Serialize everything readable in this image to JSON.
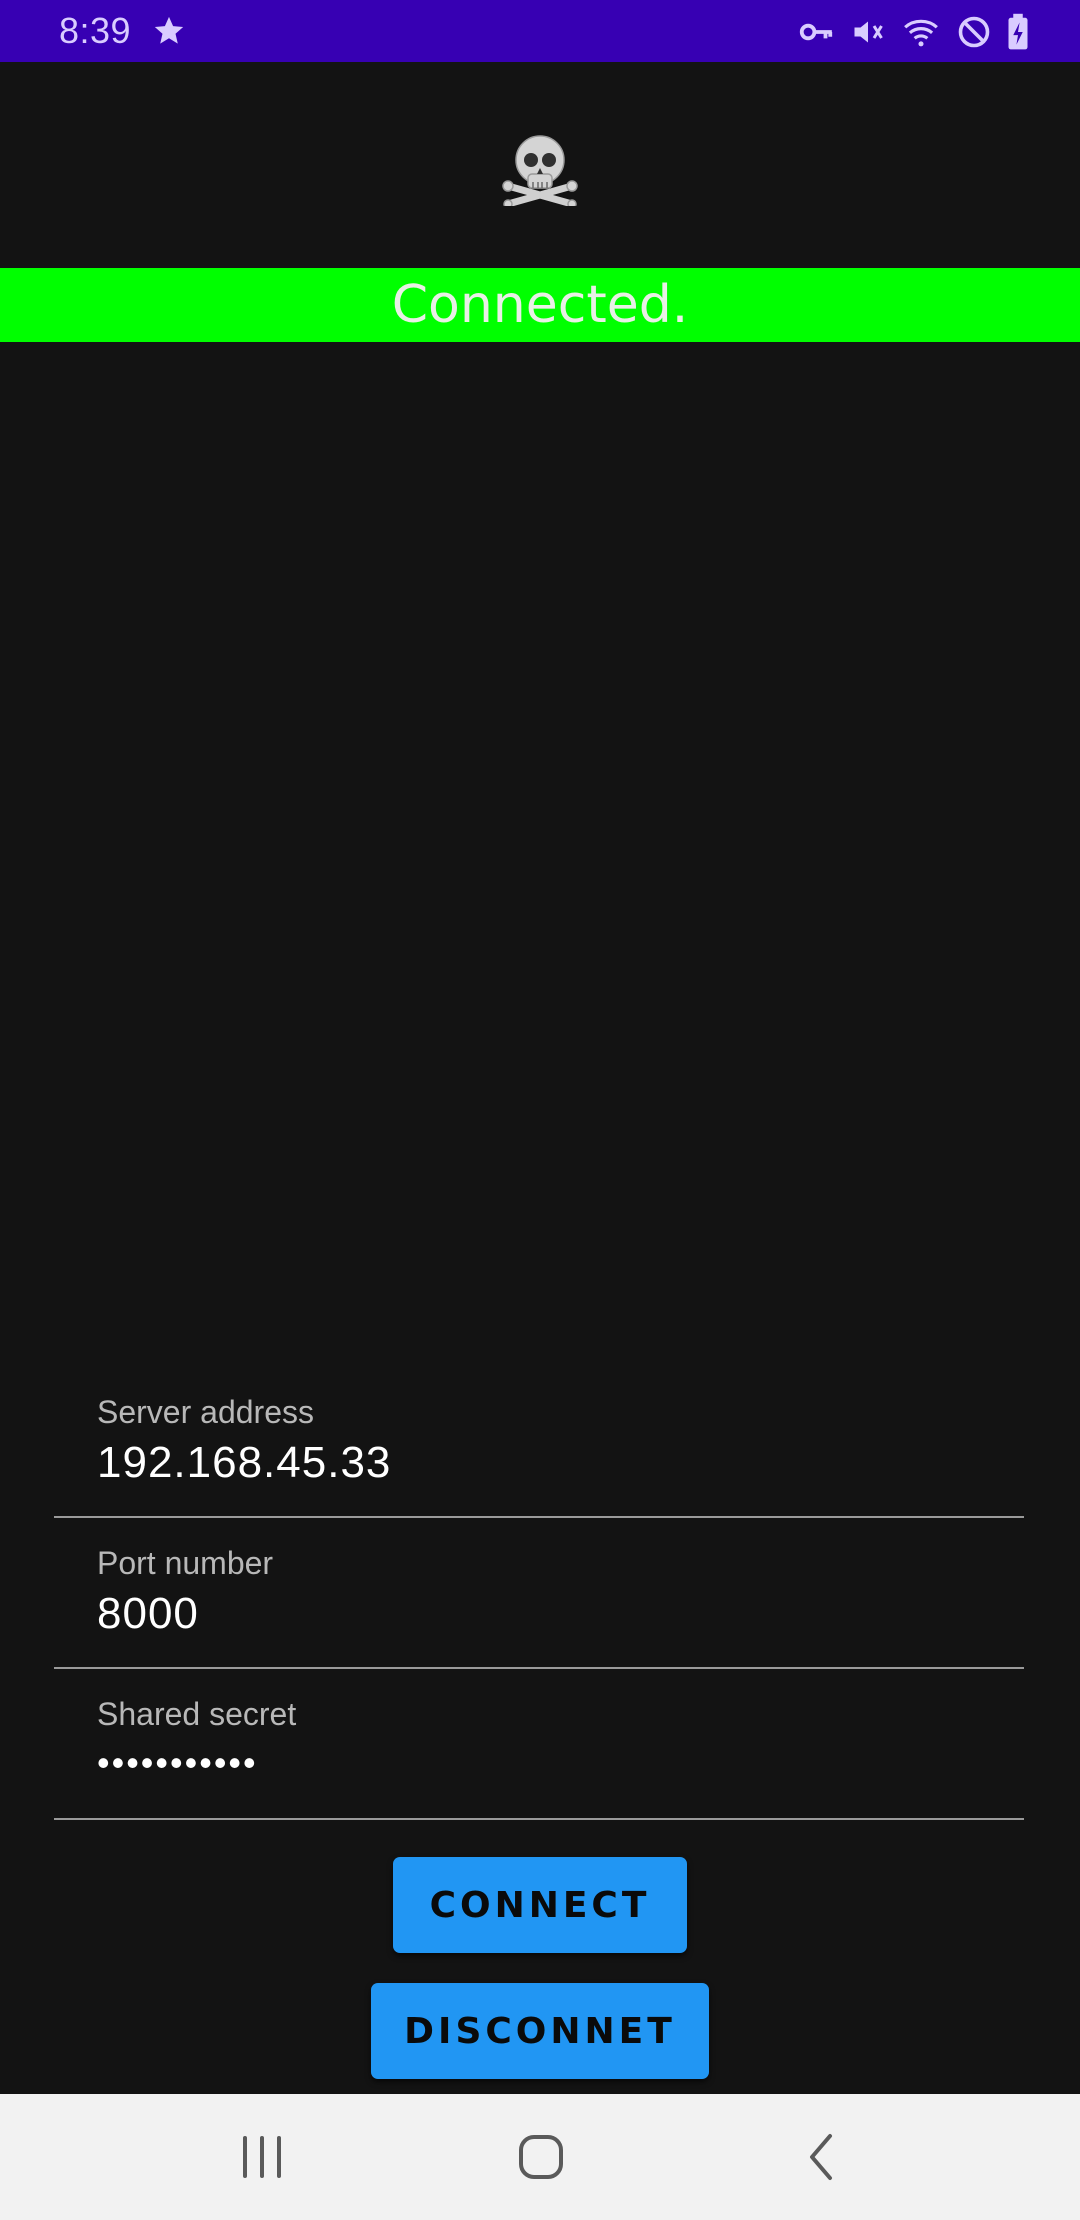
{
  "status_bar": {
    "time": "8:39",
    "icons": [
      "star-icon",
      "vpn-key-icon",
      "mute-icon",
      "wifi-icon",
      "do-not-disturb-icon",
      "battery-charging-icon"
    ]
  },
  "app": {
    "logo": "skull-crossbones-icon",
    "connection_status": "Connected.",
    "status_color": "#00ff00"
  },
  "form": {
    "server_address": {
      "label": "Server address",
      "value": "192.168.45.33"
    },
    "port_number": {
      "label": "Port number",
      "value": "8000"
    },
    "shared_secret": {
      "label": "Shared secret",
      "value": "•••••••••••"
    }
  },
  "buttons": {
    "connect": "CONNECT",
    "disconnect": "DISCONNET"
  },
  "nav_bar": {
    "icons": [
      "recents-icon",
      "home-icon",
      "back-icon"
    ]
  },
  "colors": {
    "status_bar": "#3700b3",
    "background": "#131313",
    "button": "#2196f3"
  }
}
